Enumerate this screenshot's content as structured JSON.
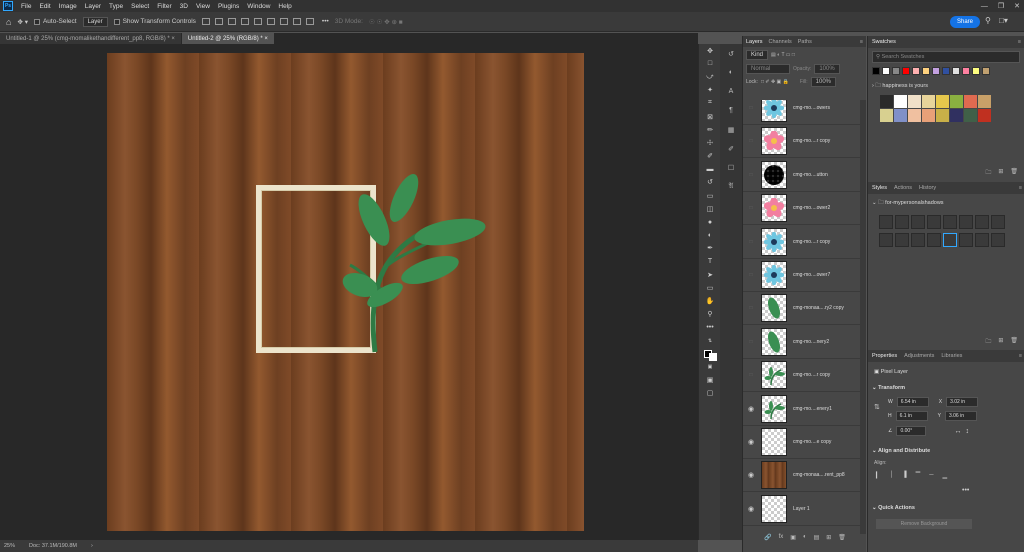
{
  "app": {
    "logo": "Ps",
    "menu": [
      "File",
      "Edit",
      "Image",
      "Layer",
      "Type",
      "Select",
      "Filter",
      "3D",
      "View",
      "Plugins",
      "Window",
      "Help"
    ]
  },
  "options": {
    "auto_select": "Auto-Select",
    "layer_select": "Layer",
    "show_transform": "Show Transform Controls",
    "mode3d": "3D Mode:",
    "share": "Share"
  },
  "tabs": [
    "Untitled-1 @ 25% (cmg-momalikethandifferent_pp8, RGB/8) *",
    "Untitled-2 @ 25% (RGB/8) *"
  ],
  "status": {
    "zoom": "25%",
    "doc": "Doc: 37.1M/190.8M"
  },
  "layers_panel": {
    "tabs": [
      "Layers",
      "Channels",
      "Paths"
    ],
    "kind": "Kind",
    "blend": "Normal",
    "opacity_label": "Opacity:",
    "opacity": "100%",
    "lock_label": "Lock:",
    "fill_label": "Fill:",
    "fill": "100%",
    "rows": [
      {
        "name": "cmg-mo....owers",
        "visible": false,
        "thumb": "flower-blue"
      },
      {
        "name": "cmg-mo....r copy",
        "visible": false,
        "thumb": "flower-pink"
      },
      {
        "name": "cmg-mo....utton",
        "visible": false,
        "thumb": "plaid"
      },
      {
        "name": "cmg-mo....ower2",
        "visible": false,
        "thumb": "flower-pink"
      },
      {
        "name": "cmg-mo....r copy",
        "visible": false,
        "thumb": "flower-blue"
      },
      {
        "name": "cmg-mo....ower7",
        "visible": false,
        "thumb": "flower-blue"
      },
      {
        "name": "cmg-monaa....ry2 copy",
        "visible": false,
        "thumb": "leaf"
      },
      {
        "name": "cmg-mo....nery2",
        "visible": false,
        "thumb": "leaf"
      },
      {
        "name": "cmg-mo....r copy",
        "visible": false,
        "thumb": "branch"
      },
      {
        "name": "cmg-mo....enery1",
        "visible": true,
        "thumb": "branch"
      },
      {
        "name": "cmg-mo....e copy",
        "visible": true,
        "thumb": "empty"
      },
      {
        "name": "cmg-monaa....rent_pp8",
        "visible": true,
        "thumb": "wood"
      },
      {
        "name": "Layer 1",
        "visible": true,
        "thumb": "empty"
      }
    ]
  },
  "swatches": {
    "title": "Swatches",
    "search": "Search Swatches",
    "group": "happiness is yours",
    "top": [
      "#000000",
      "#ffffff",
      "#888888",
      "#ff0000",
      "#ffb0b0",
      "#ffd27f",
      "#c3a0e0",
      "#3050a0",
      "#e0e0e0",
      "#ff80a0",
      "#ffff80",
      "#c0a070"
    ],
    "grid": [
      "#2a2a2a",
      "#ffffff",
      "#f0e0c8",
      "#e8d49a",
      "#e6c84c",
      "#8ab040",
      "#e06a50",
      "#c8a068",
      "#d8d090",
      "#8090c8",
      "#f0c0a0",
      "#e8a078",
      "#c8b048",
      "#303060",
      "#406048",
      "#c03020"
    ]
  },
  "styles": {
    "tabs": [
      "Styles",
      "Actions",
      "History"
    ],
    "group": "for-mypersonalshadows"
  },
  "properties": {
    "tabs": [
      "Properties",
      "Adjustments",
      "Libraries"
    ],
    "pixel_layer": "Pixel Layer",
    "transform": "Transform",
    "w": "6.54 in",
    "x": "3.02 in",
    "h": "6.1 in",
    "y": "3.06 in",
    "angle": "0.00°",
    "align": "Align and Distribute",
    "align_label": "Align:",
    "quick": "Quick Actions",
    "remove_bg": "Remove Background"
  },
  "colors": {
    "accent": "#31a8ff",
    "share": "#1473e6",
    "leaf": "#3a8f52",
    "frame": "#ece4cc"
  }
}
